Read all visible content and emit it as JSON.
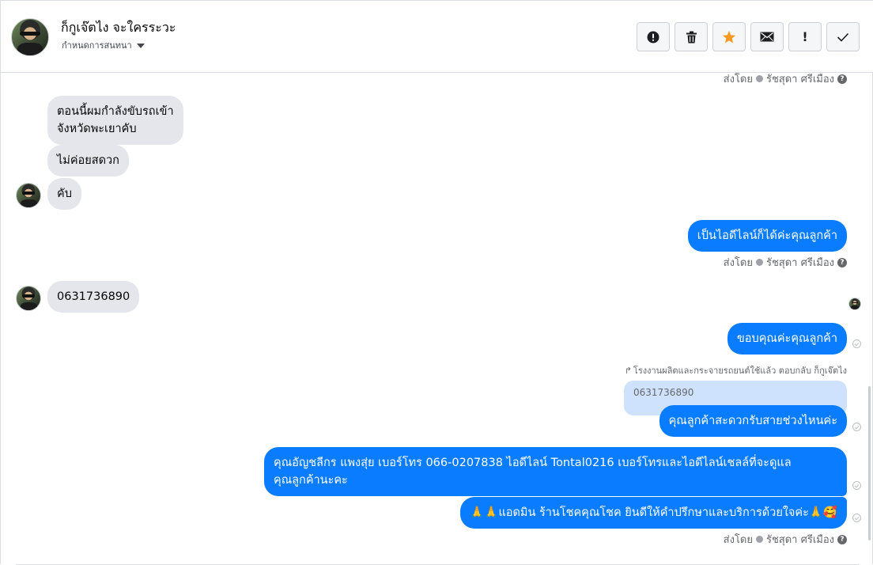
{
  "header": {
    "contact_name": "ก็กูเจ๊ตไง จะใครระวะ",
    "assign_label": "กำหนดการสนทนา",
    "toolbar": [
      {
        "name": "spam",
        "icon": "alert-circle-icon",
        "label": ""
      },
      {
        "name": "delete",
        "icon": "trash-icon",
        "label": ""
      },
      {
        "name": "star",
        "icon": "star-icon",
        "label": ""
      },
      {
        "name": "unread",
        "icon": "envelope-icon",
        "label": ""
      },
      {
        "name": "follow-up",
        "icon": "exclamation-icon",
        "label": "!"
      },
      {
        "name": "done",
        "icon": "checkmark-icon",
        "label": ""
      }
    ]
  },
  "colors": {
    "outgoing_bubble": "#0a7cff",
    "incoming_bubble": "#e4e6eb",
    "star": "#f59a23",
    "quoted_bubble": "#cfe2fd"
  },
  "sent_by": {
    "prefix": "ส่งโดย",
    "agent": "รัชสุดา ศรีเมือง",
    "help_icon": "?"
  },
  "messages": {
    "m1": "ตอนนี้ผมกำลังขับรถเข้า\nจังหวัดพะเยาคับ",
    "m2": "ไม่ค่อยสดวก",
    "m3": "คับ",
    "m4": "เป็นไอดีไลน์ก็ได้ค่ะคุณลูกค้า",
    "m5": "0631736890",
    "m6": "ขอบคุณค่ะคุณลูกค้า",
    "reply_context": "โรงงานผลิตและกระจายรถยนต์ใช้แล้ว ตอบกลับ ก็กูเจ๊ตไง",
    "quoted_text": "0631736890",
    "m7": "คุณลูกค้าสะดวกรับสายช่วงไหนค่ะ",
    "m8": "คุณอัญชลีกร แพงสุ่ย      เบอร์โทร 066-0207838 ไอดีไลน์ Tontal0216   เบอร์โทรและไอดีไลน์เชลล์ที่จะดูแล\nคุณลูกค้านะคะ",
    "m9": "🙏🙏แอดมิน ร้านโชคคุณโชค ยินดีให้คำปรึกษาและบริการด้วยใจค่ะ🙏🥰"
  }
}
